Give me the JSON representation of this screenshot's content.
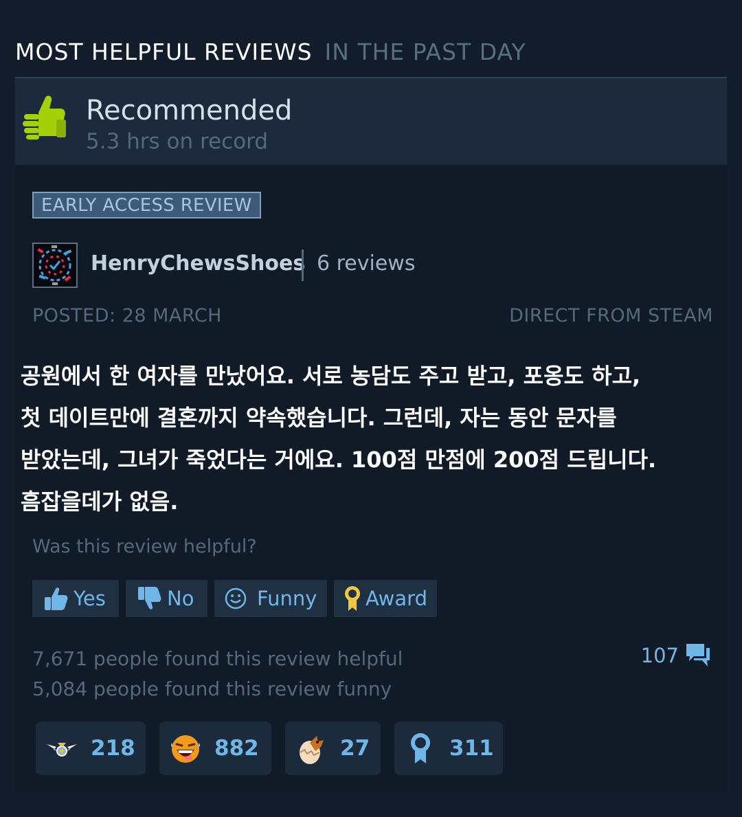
{
  "section": {
    "title": "MOST HELPFUL REVIEWS",
    "subtitle": "IN THE PAST DAY"
  },
  "review": {
    "recommendation": "Recommended",
    "hours": "5.3 hrs on record",
    "badge": "EARLY ACCESS REVIEW",
    "author": "HenryChewsShoes",
    "author_reviews": "6 reviews",
    "posted": "POSTED: 28 MARCH",
    "source": "DIRECT FROM STEAM",
    "text_lines": [
      "공원에서 한 여자를 만났어요. 서로 농담도 주고 받고, 포옹도 하고,",
      "첫 데이트만에 결혼까지 약속했습니다. 그런데, 자는 동안 문자를",
      "받았는데, 그녀가 죽었다는 거에요. 100점 만점에 200점 드립니다.",
      "흠잡을데가 없음."
    ],
    "helpful_question": "Was this review helpful?",
    "helpful_count_text": "7,671 people found this review helpful",
    "funny_count_text": "5,084 people found this review funny",
    "comment_count": "107"
  },
  "vote_buttons": [
    {
      "label": "Yes",
      "icon": "thumbs-up-icon"
    },
    {
      "label": "No",
      "icon": "thumbs-down-icon"
    },
    {
      "label": "Funny",
      "icon": "smiley-icon"
    },
    {
      "label": "Award",
      "icon": "award-ribbon-icon"
    }
  ],
  "awards": [
    {
      "icon": "winged-heart-icon",
      "count": "218"
    },
    {
      "icon": "laughing-face-icon",
      "count": "882"
    },
    {
      "icon": "dragon-egg-icon",
      "count": "27"
    },
    {
      "icon": "ribbon-medal-icon",
      "count": "311"
    }
  ],
  "colors": {
    "background": "#131c2a",
    "card": "#111a27",
    "header": "#1c2a3b",
    "thumb_green": "#a4d007",
    "link_blue": "#6fb7e8",
    "muted": "#56697b"
  }
}
